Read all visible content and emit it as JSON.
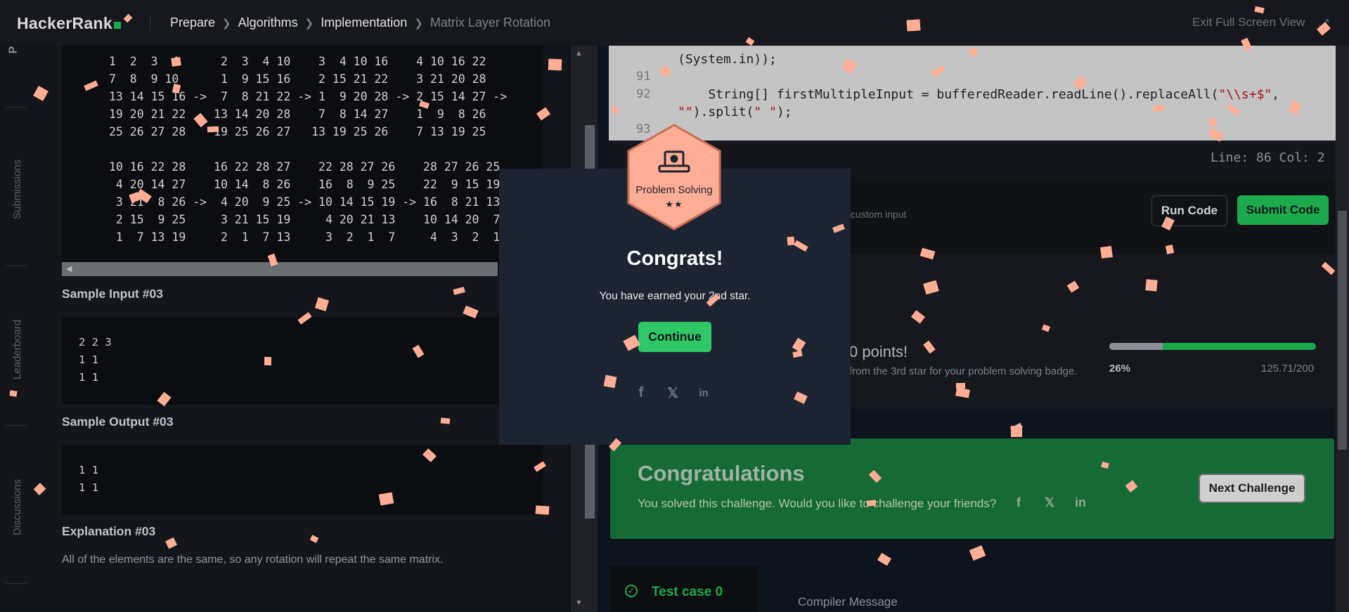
{
  "header": {
    "logo": "HackerRank",
    "breadcrumbs": [
      "Prepare",
      "Algorithms",
      "Implementation",
      "Matrix Layer Rotation"
    ],
    "exit_label": "Exit Full Screen View"
  },
  "siderail": {
    "problem_letter": "P",
    "items": [
      "Submissions",
      "Leaderboard",
      "Discussions"
    ]
  },
  "problem": {
    "matrix_lines": [
      "1  2  3  4      2  3  4 10    3  4 10 16    4 10 16 22",
      "7  8  9 10      1  9 15 16    2 15 21 22    3 21 20 28",
      "13 14 15 16 ->  7  8 21 22 -> 1  9 20 28 -> 2 15 14 27 ->",
      "19 20 21 22    13 14 20 28    7  8 14 27    1  9  8 26",
      "25 26 27 28    19 25 26 27   13 19 25 26    7 13 19 25",
      "",
      "10 16 22 28    16 22 28 27    22 28 27 26    28 27 26 25",
      " 4 20 14 27    10 14  8 26    16  8  9 25    22  9 15 19",
      " 3 21  8 26 ->  4 20  9 25 -> 10 14 15 19 -> 16  8 21 13",
      " 2 15  9 25     3 21 15 19     4 20 21 13    10 14 20  7",
      " 1  7 13 19     2  1  7 13     3  2  1  7     4  3  2  1"
    ],
    "sample_input_title": "Sample Input #03",
    "sample_input_lines": [
      "2 2 3",
      "1 1",
      "1 1"
    ],
    "sample_output_title": "Sample Output #03",
    "sample_output_lines": [
      "1 1",
      "1 1"
    ],
    "explanation_title": "Explanation #03",
    "explanation_text": "All of the elements are the same, so any rotation will repeat the same matrix."
  },
  "editor": {
    "line_numbers": [
      "91",
      "92",
      "93"
    ],
    "line_1": "(System.in));",
    "line_2_pre": "    String[] firstMultipleInput = bufferedReader.readLine().replaceAll(",
    "line_2_str": "\"\\\\s+$\"",
    "line_2_post": ",",
    "line_3_pre": "\"\"",
    "line_3_mid": ").split(",
    "line_3_str": "\" \"",
    "line_3_post": ");",
    "status": "Line: 86 Col: 2"
  },
  "actions": {
    "custom_input_label": "custom input",
    "run_label": "Run Code",
    "submit_label": "Submit Code"
  },
  "progress": {
    "points_text": "0 points!",
    "subtext": "from the 3rd star for your problem solving badge.",
    "percent_label": "26%",
    "fraction": 0.26,
    "score": "125.71/200"
  },
  "success": {
    "title": "Congratulations",
    "text": "You solved this challenge. Would you like to challenge your friends?",
    "next_label": "Next Challenge",
    "icons": [
      "facebook-icon",
      "twitter-icon",
      "linkedin-icon"
    ]
  },
  "results": {
    "testcase_label": "Test case 0",
    "compiler_label": "Compiler Message"
  },
  "modal": {
    "badge_title": "Problem Solving",
    "badge_stars": "★★",
    "title": "Congrats!",
    "message": "You have earned your 2nd star.",
    "continue_label": "Continue",
    "share_icons": [
      "facebook-icon",
      "twitter-icon",
      "linkedin-icon"
    ]
  },
  "colors": {
    "accent_green": "#1ba94c",
    "confetti": "#ffad94",
    "modal_bg": "#1d2431",
    "badge": "#ffad94"
  }
}
